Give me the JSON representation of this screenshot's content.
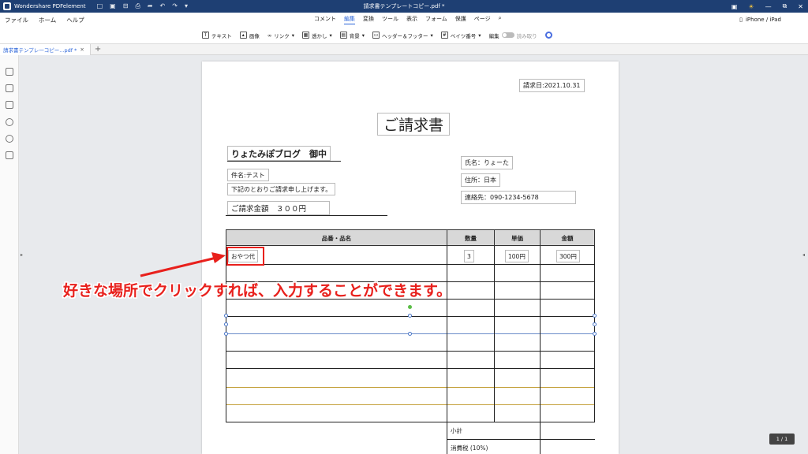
{
  "app": {
    "name": "Wondershare PDFelement",
    "document_title": "請求書テンプレートコピー.pdf *"
  },
  "quick_access": [
    "□",
    "▣",
    "⊟",
    "⎙",
    "➦",
    "↶",
    "↷",
    "▾"
  ],
  "window_controls": [
    "▣",
    "☀",
    "—",
    "⧉",
    "✕"
  ],
  "menu": {
    "left": [
      "ファイル",
      "ホーム",
      "ヘルプ"
    ],
    "center": [
      "コメント",
      "編集",
      "変換",
      "ツール",
      "表示",
      "フォーム",
      "保護",
      "ページ"
    ],
    "active": "編集",
    "device_label": "iPhone / iPad"
  },
  "toolbar": {
    "text": "テキスト",
    "image": "画像",
    "link": "リンク",
    "watermark": "透かし",
    "background": "背景",
    "header_footer": "ヘッダー＆フッター",
    "bates": "ベイツ番号",
    "edit": "編集",
    "read": "読み取り"
  },
  "tab": {
    "label": "請求書テンプレ一コピー...pdf *",
    "close": "✕",
    "add": "+"
  },
  "doc": {
    "date": "請求日:2021.10.31",
    "title": "ご請求書",
    "recipient": "りょたみぽブログ　御中",
    "subject": "件名:テスト",
    "note": "下記のとおりご請求申し上げます。",
    "amount": "ご請求金額　３００円",
    "name": "氏名：りょーた",
    "address": "住所：日本",
    "contact": "連絡先：090-1234-5678",
    "table_headers": [
      "品番・品名",
      "数量",
      "単価",
      "金額"
    ],
    "row1": {
      "item": "おやつ代",
      "qty": "3",
      "unit": "100円",
      "amount": "300円"
    },
    "subtotal": "小計",
    "tax": "消費税 (10%)"
  },
  "annotation": "好きな場所でクリックすれば、入力することができます。",
  "colors": {
    "annotation": "#e8201c",
    "titlebar": "#1e3f73",
    "accent": "#2b65d9"
  },
  "page_indicator": "1 / 1"
}
